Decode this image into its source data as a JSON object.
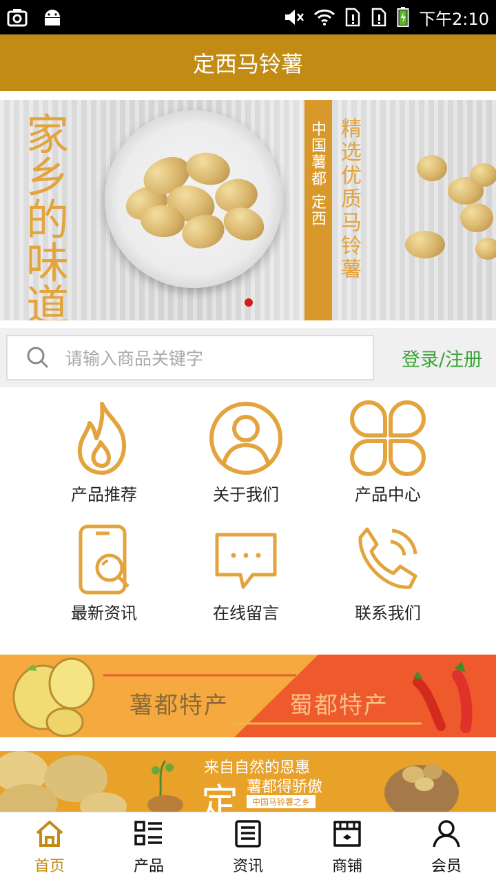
{
  "status_bar": {
    "time": "下午2:10"
  },
  "header": {
    "title": "定西马铃薯"
  },
  "banner": {
    "left_text": "家乡的味道",
    "strip_text": "中国薯都",
    "strip_sub": "定西",
    "right_text": "精选优质马铃薯"
  },
  "search": {
    "placeholder": "请输入商品关键字",
    "login_label": "登录/注册"
  },
  "grid": {
    "items": [
      {
        "label": "产品推荐",
        "icon": "flame-icon"
      },
      {
        "label": "关于我们",
        "icon": "user-icon"
      },
      {
        "label": "产品中心",
        "icon": "clover-grid-icon"
      },
      {
        "label": "最新资讯",
        "icon": "phone-search-icon"
      },
      {
        "label": "在线留言",
        "icon": "chat-bubble-icon"
      },
      {
        "label": "联系我们",
        "icon": "phone-call-icon"
      }
    ]
  },
  "promo": {
    "left": "薯都特产",
    "right": "蜀都特产"
  },
  "banner2": {
    "line1": "来自自然的恩惠",
    "big": "定",
    "line2": "薯都得骄傲",
    "pill": "中国马铃薯之乡"
  },
  "tabbar": {
    "items": [
      {
        "label": "首页",
        "icon": "home-icon"
      },
      {
        "label": "产品",
        "icon": "list-icon"
      },
      {
        "label": "资讯",
        "icon": "news-icon"
      },
      {
        "label": "商铺",
        "icon": "store-icon"
      },
      {
        "label": "会员",
        "icon": "member-icon"
      }
    ]
  },
  "colors": {
    "brand": "#c18b14",
    "accent": "#e3a33d",
    "login": "#3aa336"
  }
}
